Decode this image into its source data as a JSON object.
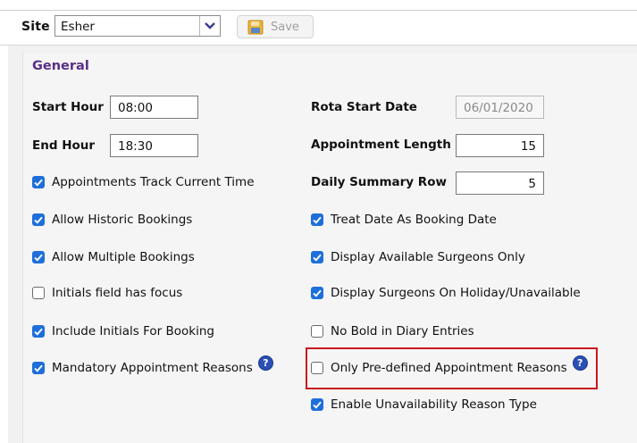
{
  "toolbar": {
    "site_label": "Site",
    "site_value": "Esher",
    "save_label": "Save"
  },
  "general": {
    "title": "General",
    "start_hour": {
      "label": "Start Hour",
      "value": "08:00"
    },
    "end_hour": {
      "label": "End Hour",
      "value": "18:30"
    },
    "rota_start_date": {
      "label": "Rota Start Date",
      "value": "06/01/2020"
    },
    "appointment_length": {
      "label": "Appointment Length",
      "value": "15"
    },
    "daily_summary_row": {
      "label": "Daily Summary Row",
      "value": "5"
    },
    "left_checkboxes": [
      {
        "label": "Appointments Track Current Time",
        "checked": true
      },
      {
        "label": "Allow Historic Bookings",
        "checked": true
      },
      {
        "label": "Allow Multiple Bookings",
        "checked": true
      },
      {
        "label": "Initials field has focus",
        "checked": false
      },
      {
        "label": "Include Initials For Booking",
        "checked": true
      },
      {
        "label": "Mandatory Appointment Reasons",
        "checked": true,
        "help": true
      }
    ],
    "right_checkboxes": [
      {
        "label": "Treat Date As Booking Date",
        "checked": true
      },
      {
        "label": "Display Available Surgeons Only",
        "checked": true
      },
      {
        "label": "Display Surgeons On Holiday/Unavailable",
        "checked": true
      },
      {
        "label": "No Bold in Diary Entries",
        "checked": false
      },
      {
        "label": "Only Pre-defined Appointment Reasons",
        "checked": false,
        "help": true
      },
      {
        "label": "Enable Unavailability Reason Type",
        "checked": true
      }
    ]
  },
  "colors": {
    "accent": "#1e6fd9",
    "section_title": "#5a2e86",
    "highlight": "#c8191e"
  }
}
